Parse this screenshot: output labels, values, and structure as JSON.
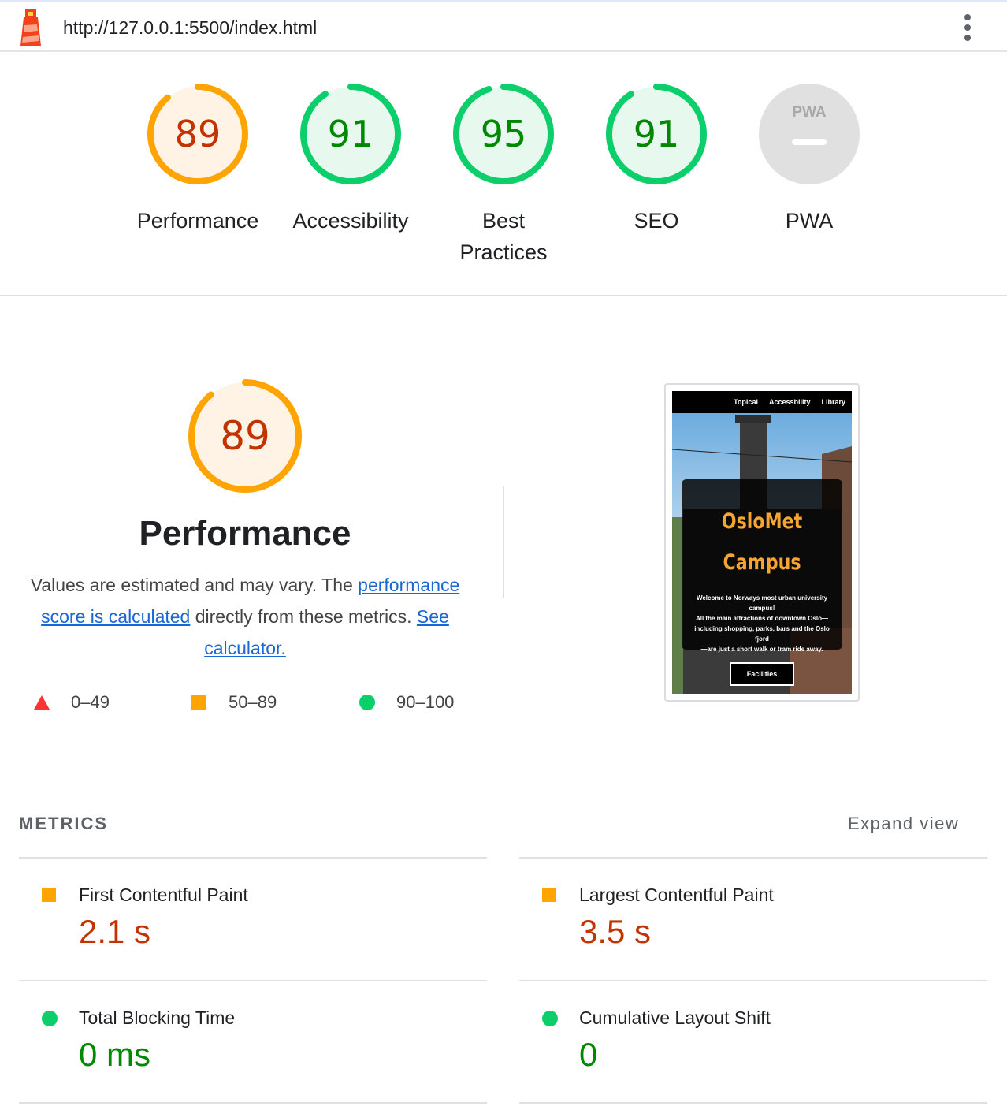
{
  "topbar": {
    "url": "http://127.0.0.1:5500/index.html",
    "logo_icon": "lighthouse-icon",
    "menu_icon": "kebab-menu-icon"
  },
  "colors": {
    "average": "#ffa400",
    "average_fill": "#fff3e6",
    "average_text": "#c33300",
    "pass": "#0cce6b",
    "pass_fill": "#e7f9ee",
    "pass_text": "#008800",
    "fail": "#ff3333",
    "na": "#e0e0e0",
    "link": "#1967d2"
  },
  "gauges": [
    {
      "label": "Performance",
      "score": "89",
      "value": 0.89,
      "status": "average"
    },
    {
      "label": "Accessibility",
      "score": "91",
      "value": 0.91,
      "status": "pass"
    },
    {
      "label": "Best Practices",
      "score": "95",
      "value": 0.95,
      "status": "pass"
    },
    {
      "label": "SEO",
      "score": "91",
      "value": 0.91,
      "status": "pass"
    },
    {
      "label": "PWA",
      "score": "PWA",
      "value": null,
      "status": "na"
    }
  ],
  "performance": {
    "score": "89",
    "value": 0.89,
    "title": "Performance",
    "desc_1": "Values are estimated and may vary. The ",
    "link_1": "performance score is calculated",
    "desc_2": " directly from these metrics. ",
    "link_2": "See calculator.",
    "legend": [
      {
        "range": "0–49",
        "shape": "triangle-icon"
      },
      {
        "range": "50–89",
        "shape": "square-icon"
      },
      {
        "range": "90–100",
        "shape": "circle-icon"
      }
    ]
  },
  "screenshot": {
    "nav": [
      "Topical",
      "Accessbility",
      "Library"
    ],
    "title_1": "OsloMet",
    "title_2": "Campus",
    "text_1": "Welcome to Norways most urban university campus!",
    "text_2": "All the main attractions of downtown Oslo—",
    "text_3": "including shopping, parks, bars and the Oslo fjord",
    "text_4": "—are just a short walk or tram ride away.",
    "button": "Facilities"
  },
  "metrics": {
    "heading": "METRICS",
    "expand": "Expand view",
    "items": [
      {
        "name": "First Contentful Paint",
        "value": "2.1 s",
        "status": "average"
      },
      {
        "name": "Largest Contentful Paint",
        "value": "3.5 s",
        "status": "average"
      },
      {
        "name": "Total Blocking Time",
        "value": "0 ms",
        "status": "pass"
      },
      {
        "name": "Cumulative Layout Shift",
        "value": "0",
        "status": "pass"
      }
    ]
  }
}
